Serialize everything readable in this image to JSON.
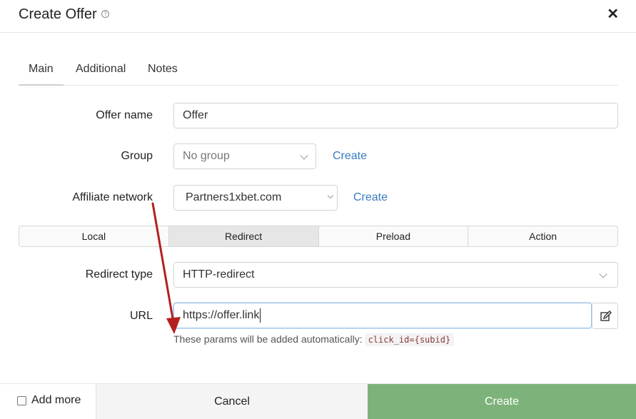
{
  "dialog": {
    "title": "Create Offer",
    "help_glyph": "?"
  },
  "tabs": [
    {
      "label": "Main",
      "active": true
    },
    {
      "label": "Additional",
      "active": false
    },
    {
      "label": "Notes",
      "active": false
    }
  ],
  "form": {
    "offer_name": {
      "label": "Offer name",
      "value": "Offer"
    },
    "group": {
      "label": "Group",
      "value": "No group",
      "create_link": "Create"
    },
    "affiliate_network": {
      "label": "Affiliate network",
      "value": "Partners1xbet.com",
      "create_link": "Create"
    },
    "modes": [
      "Local",
      "Redirect",
      "Preload",
      "Action"
    ],
    "active_mode": "Redirect",
    "redirect_type": {
      "label": "Redirect type",
      "value": "HTTP-redirect"
    },
    "url": {
      "label": "URL",
      "value": "https://offer.link"
    },
    "hint": {
      "text": "These params will be added automatically:",
      "code": "click_id={subid}"
    }
  },
  "footer": {
    "add_more": "Add more",
    "cancel": "Cancel",
    "create": "Create"
  },
  "colors": {
    "primary": "#7db37a",
    "link": "#3a7bbf",
    "annotation": "#b3201e"
  },
  "icons": {
    "close": "close-icon",
    "help": "help-icon",
    "edit": "edit-icon",
    "chevron": "chevron-down-icon"
  }
}
